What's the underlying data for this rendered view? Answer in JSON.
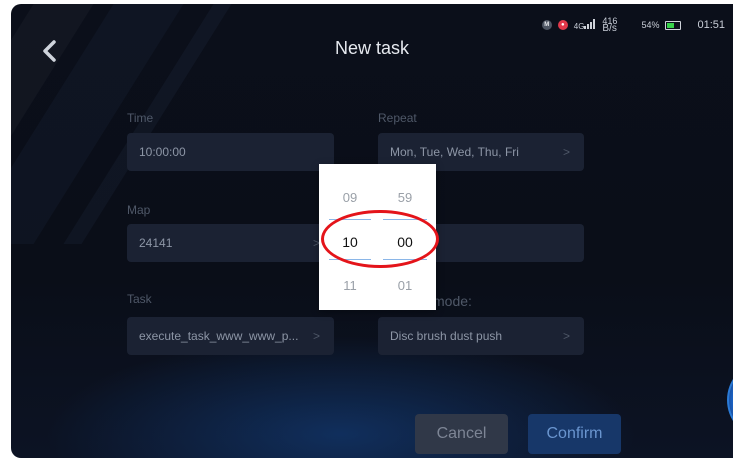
{
  "header": {
    "title": "New task",
    "back_icon": "chevron-left-icon"
  },
  "status_bar": {
    "icons": [
      "m-badge-icon",
      "location-pin-icon"
    ],
    "network": "4G",
    "speed_value": "416",
    "speed_unit": "B/s",
    "battery_percent": "54%",
    "time": "01:51"
  },
  "form": {
    "time_label": "Time",
    "time_value": "10:00:00",
    "repeat_label": "Repeat",
    "repeat_value": "Mon,  Tue,  Wed,  Thu,  Fri",
    "map_label": "Map",
    "map_value": "24141",
    "task_label": "Task",
    "task_value": "execute_task_www_www_p...",
    "mode_label": "mode:",
    "mode_value": "Disc brush dust push"
  },
  "picker": {
    "hours": [
      "09",
      "10",
      "11"
    ],
    "minutes": [
      "59",
      "00",
      "01"
    ],
    "selected_index": 1
  },
  "buttons": {
    "cancel": "Cancel",
    "confirm": "Confirm"
  },
  "colors": {
    "accent": "#173769",
    "highlight_ring": "#e4141a",
    "background": "#0b0f1a"
  }
}
